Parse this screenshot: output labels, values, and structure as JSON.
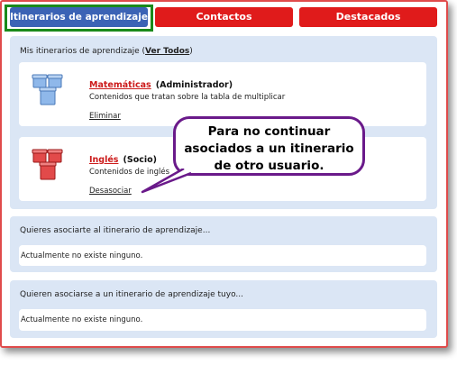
{
  "tabs": [
    {
      "label": "Itinerarios de aprendizaje",
      "active": true
    },
    {
      "label": "Contactos",
      "active": false
    },
    {
      "label": "Destacados",
      "active": false
    }
  ],
  "my_itineraries": {
    "title": "Mis itinerarios de aprendizaje (",
    "see_all": "Ver Todos",
    "title_close": ")",
    "items": [
      {
        "name": "Matemáticas",
        "role": "(Administrador)",
        "description": "Contenidos que tratan sobre la tabla de multiplicar",
        "action": "Eliminar",
        "icon_color": "#6a9ad8"
      },
      {
        "name": "Inglés",
        "role": "(Socio)",
        "description": "Contenidos de inglés",
        "action": "Desasociar",
        "icon_color": "#d93a3a"
      }
    ]
  },
  "want_to_associate": {
    "title": "Quieres asociarte al itinerario de aprendizaje...",
    "empty": "Actualmente no existe ninguno."
  },
  "want_to_associate_yours": {
    "title": "Quieren asociarse a un itinerario de aprendizaje tuyo...",
    "empty": "Actualmente no existe ninguno."
  },
  "callout": {
    "text": "Para no continuar\nasociados a un itinerario\nde otro usuario."
  }
}
